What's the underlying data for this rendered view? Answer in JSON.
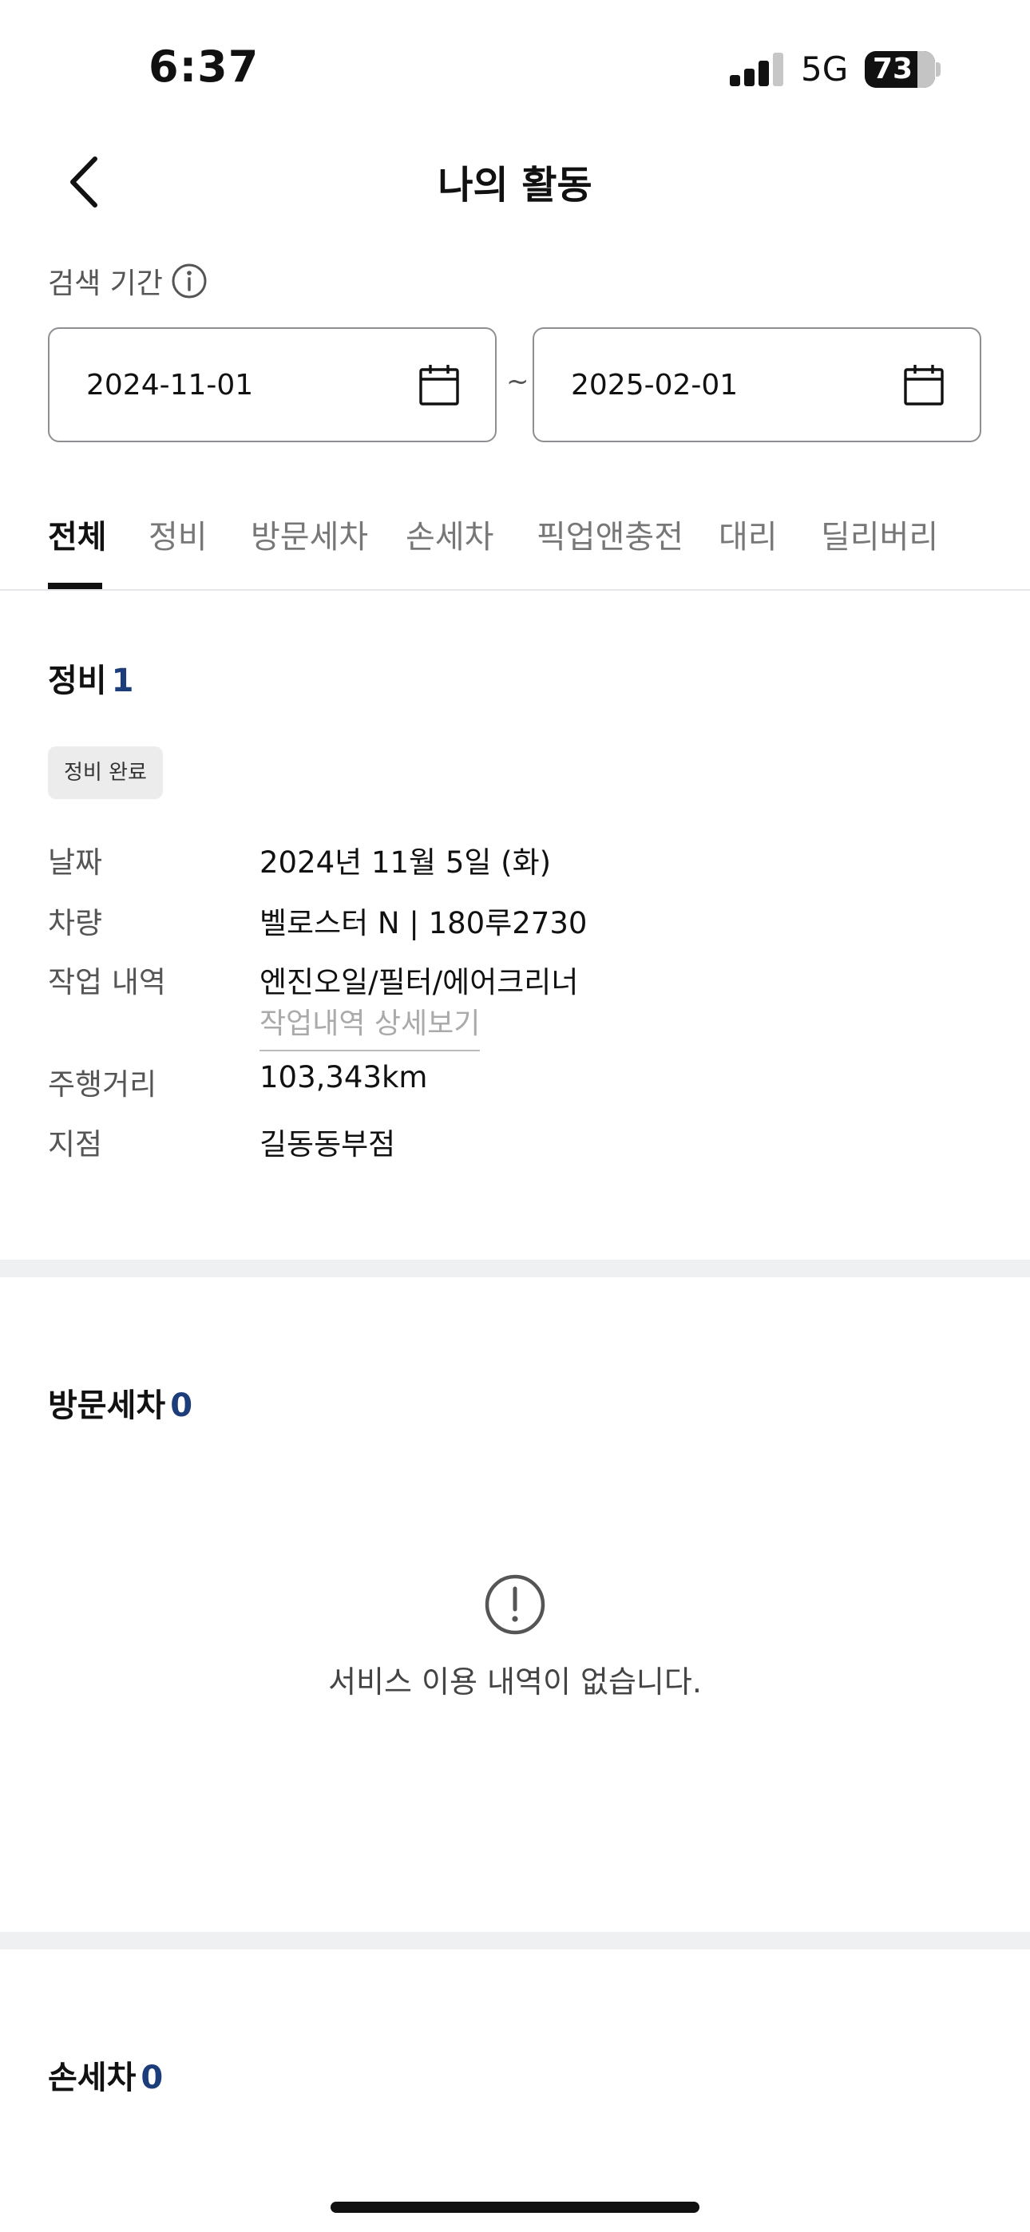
{
  "status_bar": {
    "time": "6:37",
    "network": "5G",
    "battery": "73"
  },
  "header": {
    "title": "나의 활동"
  },
  "search": {
    "label": "검색 기간",
    "from": "2024-11-01",
    "separator": "~",
    "to": "2025-02-01"
  },
  "tabs": [
    {
      "label": "전체",
      "active": true
    },
    {
      "label": "정비"
    },
    {
      "label": "방문세차"
    },
    {
      "label": "손세차"
    },
    {
      "label": "픽업앤충전"
    },
    {
      "label": "대리"
    },
    {
      "label": "딜리버리"
    }
  ],
  "maintenance": {
    "title": "정비",
    "count": "1",
    "badge": "정비 완료",
    "rows": [
      {
        "key": "날짜",
        "value": "2024년 11월 5일 (화)"
      },
      {
        "key": "차량",
        "value": "벨로스터 N | 180루2730"
      },
      {
        "key": "작업 내역",
        "value": "엔진오일/필터/에어크리너"
      },
      {
        "key": "주행거리",
        "value": "103,343km"
      },
      {
        "key": "지점",
        "value": "길동동부점"
      }
    ],
    "detail_link": "작업내역 상세보기"
  },
  "visit_wash": {
    "title": "방문세차",
    "count": "0",
    "empty_message": "서비스 이용 내역이 없습니다."
  },
  "hand_wash": {
    "title": "손세차",
    "count": "0"
  }
}
